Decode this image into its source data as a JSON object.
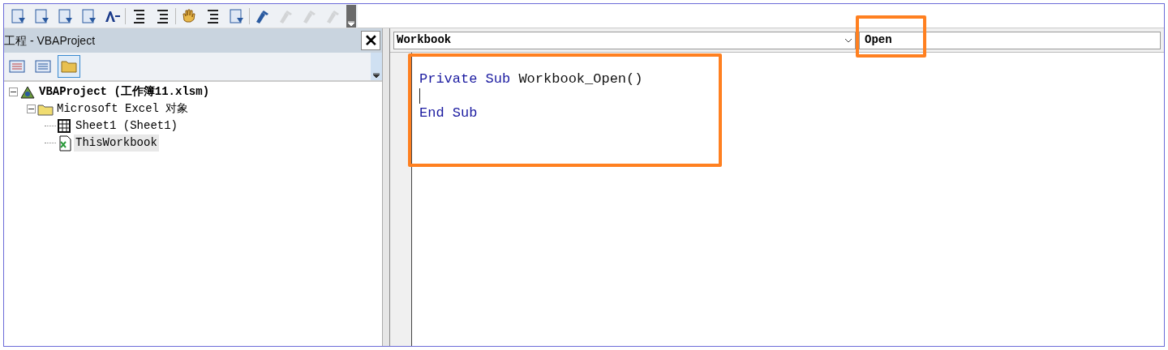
{
  "toolbar": [
    {
      "disabled": false
    },
    {
      "disabled": false
    },
    {
      "disabled": false
    },
    {
      "disabled": false
    },
    {
      "disabled": false
    },
    {
      "disabled": false
    },
    {
      "disabled": false
    },
    {
      "disabled": false
    },
    {
      "disabled": false
    },
    {
      "disabled": false
    },
    {
      "disabled": false
    },
    {
      "disabled": true
    },
    {
      "disabled": true
    },
    {
      "disabled": true
    }
  ],
  "project_panel": {
    "title": "工程 - VBAProject",
    "close": "✕",
    "view_buttons": [
      {
        "selected": false
      },
      {
        "selected": false
      },
      {
        "selected": true
      }
    ],
    "tree": [
      {
        "label": "VBAProject (工作簿11.xlsm)",
        "kind": "project",
        "expanded": true,
        "selected": false,
        "children": [
          {
            "label": "Microsoft Excel 对象",
            "kind": "folder",
            "expanded": true,
            "selected": false,
            "children": [
              {
                "label": "Sheet1 (Sheet1)",
                "kind": "sheet",
                "selected": false
              },
              {
                "label": "ThisWorkbook",
                "kind": "workbook",
                "selected": true
              }
            ]
          }
        ]
      }
    ]
  },
  "code_window": {
    "object_combo": "Workbook",
    "procedure_combo": {
      "value": "Open",
      "highlighted": true
    },
    "code_highlighted": true,
    "lines": [
      {
        "tokens": [
          {
            "text": "Private Sub",
            "kind": "keyword"
          },
          {
            "text": " Workbook_Open()",
            "kind": "plain"
          }
        ]
      },
      {
        "caret": true
      },
      {
        "tokens": [
          {
            "text": "End Sub",
            "kind": "keyword"
          }
        ]
      }
    ]
  }
}
